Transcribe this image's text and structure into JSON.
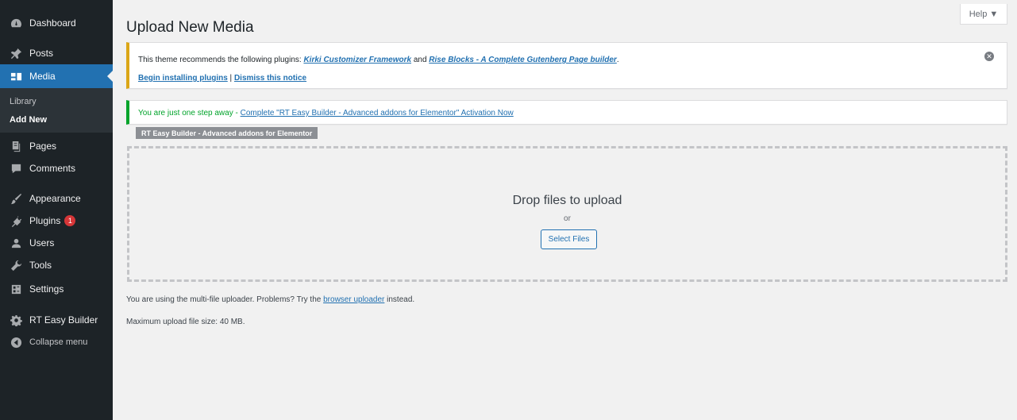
{
  "sidebar": {
    "items": [
      {
        "label": "Dashboard",
        "icon": "dashboard-icon"
      },
      {
        "label": "Posts",
        "icon": "pin-icon"
      },
      {
        "label": "Media",
        "icon": "media-icon"
      },
      {
        "label": "Pages",
        "icon": "pages-icon"
      },
      {
        "label": "Comments",
        "icon": "comments-icon"
      },
      {
        "label": "Appearance",
        "icon": "brush-icon"
      },
      {
        "label": "Plugins",
        "icon": "plugin-icon",
        "badge": "1"
      },
      {
        "label": "Users",
        "icon": "users-icon"
      },
      {
        "label": "Tools",
        "icon": "wrench-icon"
      },
      {
        "label": "Settings",
        "icon": "settings-icon"
      },
      {
        "label": "RT Easy Builder",
        "icon": "gear-icon"
      }
    ],
    "submenu": [
      "Library",
      "Add New"
    ],
    "collapse_label": "Collapse menu"
  },
  "help_tab": "Help ▼",
  "page_title": "Upload New Media",
  "notice_warning": {
    "text_before": "This theme recommends the following plugins: ",
    "plugin1": "Kirki Customizer Framework",
    "and": " and ",
    "plugin2": "Rise Blocks - A Complete Gutenberg Page builder",
    "period": ".",
    "begin_link": "Begin installing plugins",
    "separator": " | ",
    "dismiss_link": "Dismiss this notice"
  },
  "notice_success": {
    "text_before": "You are just one step away - ",
    "link": "Complete \"RT Easy Builder - Advanced addons for Elementor\" Activation Now"
  },
  "plugin_tag": "RT Easy Builder - Advanced addons for Elementor",
  "drop_zone": {
    "title": "Drop files to upload",
    "or": "or",
    "button": "Select Files"
  },
  "uploader_note": {
    "before": "You are using the multi-file uploader. Problems? Try the ",
    "link": "browser uploader",
    "after": " instead."
  },
  "max_size": "Maximum upload file size: 40 MB.",
  "colors": {
    "sidebar_bg": "#1d2327",
    "accent": "#2271b1",
    "warning": "#dba617",
    "success": "#00a32a",
    "badge": "#d63638"
  }
}
